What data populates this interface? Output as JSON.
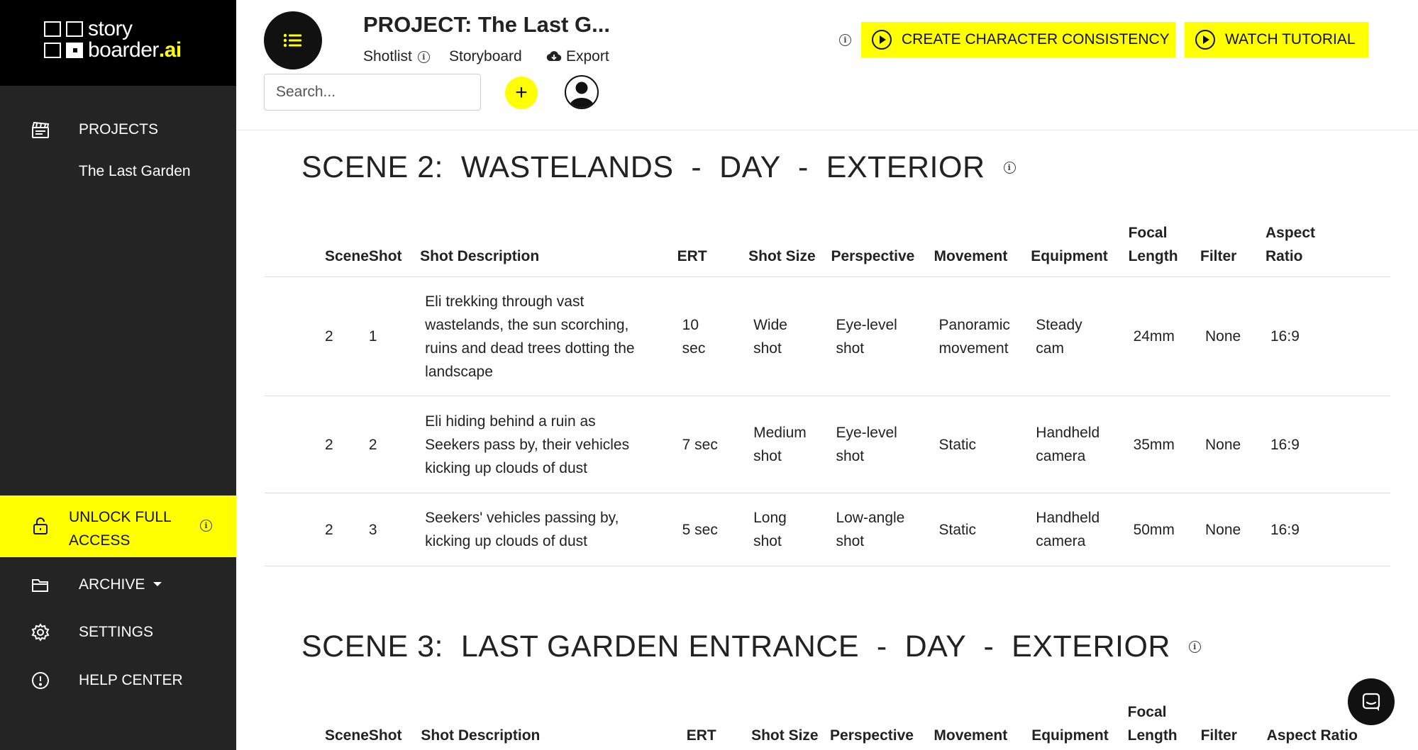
{
  "brand": {
    "line1": "story",
    "line2a": "boarder",
    "line2b": ".ai",
    "accent": "#ffff00"
  },
  "sidebar": {
    "projects_label": "PROJECTS",
    "project_item": "The Last Garden",
    "unlock_label": "UNLOCK FULL ACCESS",
    "archive_label": "ARCHIVE",
    "settings_label": "SETTINGS",
    "help_label": "HELP CENTER"
  },
  "header": {
    "project_title": "PROJECT: The Last G...",
    "tabs": {
      "shotlist": "Shotlist",
      "storyboard": "Storyboard",
      "export": "Export"
    },
    "search_placeholder": "Search...",
    "plus_label": "+",
    "create_button": "CREATE CHARACTER CONSISTENCY",
    "tutorial_button": "WATCH TUTORIAL"
  },
  "columns": [
    "Scene",
    "Shot",
    "Shot Description",
    "ERT",
    "Shot Size",
    "Perspective",
    "Movement",
    "Equipment",
    "Focal Length",
    "Filter",
    "Aspect Ratio"
  ],
  "scenes": [
    {
      "title": "SCENE 2:  WASTELANDS  -  DAY  -  EXTERIOR",
      "rows": [
        {
          "scene": "2",
          "shot": "1",
          "description": "Eli trekking through vast wastelands, the sun scorching, ruins and dead trees dotting the landscape",
          "ert": "10 sec",
          "size": "Wide shot",
          "perspective": "Eye-level shot",
          "movement": "Panoramic movement",
          "equipment": "Steady cam",
          "focal": "24mm",
          "filter": "None",
          "aspect": "16:9"
        },
        {
          "scene": "2",
          "shot": "2",
          "description": "Eli hiding behind a ruin as Seekers pass by, their vehicles kicking up clouds of dust",
          "ert": "7 sec",
          "size": "Medium shot",
          "perspective": "Eye-level shot",
          "movement": "Static",
          "equipment": "Handheld camera",
          "focal": "35mm",
          "filter": "None",
          "aspect": "16:9"
        },
        {
          "scene": "2",
          "shot": "3",
          "description": "Seekers' vehicles passing by, kicking up clouds of dust",
          "ert": "5 sec",
          "size": "Long shot",
          "perspective": "Low-angle shot",
          "movement": "Static",
          "equipment": "Handheld camera",
          "focal": "50mm",
          "filter": "None",
          "aspect": "16:9"
        }
      ]
    },
    {
      "title": "SCENE 3:  LAST GARDEN ENTRANCE  -  DAY  -  EXTERIOR",
      "rows": []
    }
  ],
  "icons": [
    "clapperboard-icon",
    "lock-icon",
    "folder-icon",
    "gear-icon",
    "alert-circle-icon",
    "list-icon",
    "info-icon",
    "cloud-download-icon",
    "user-icon",
    "play-icon",
    "chat-icon"
  ]
}
